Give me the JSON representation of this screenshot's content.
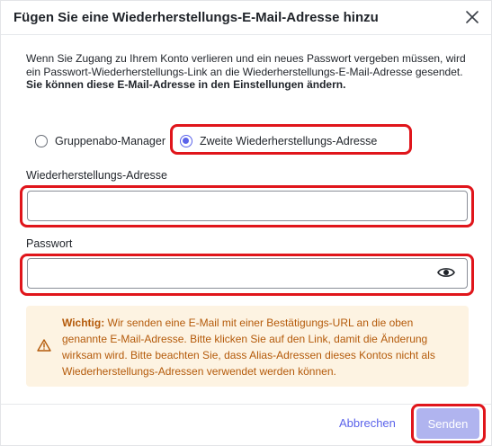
{
  "dialog": {
    "title": "Fügen Sie eine Wiederherstellungs-E-Mail-Adresse hinzu"
  },
  "intro": {
    "text": "Wenn Sie Zugang zu Ihrem Konto verlieren und ein neues Passwort vergeben müssen, wird ein Passwort-Wiederherstellungs-Link an die Wiederherstellungs-E-Mail-Adresse gesendet.",
    "bold": "Sie können diese E-Mail-Adresse in den Einstellungen ändern."
  },
  "radios": {
    "option1": "Gruppenabo-Manager",
    "option2": "Zweite Wiederherstellungs-Adresse",
    "selected": "option2"
  },
  "fields": {
    "address_label": "Wiederherstellungs-Adresse",
    "address_value": "",
    "password_label": "Passwort",
    "password_value": ""
  },
  "warning": {
    "strong": "Wichtig:",
    "text": " Wir senden eine E-Mail mit einer Bestätigungs-URL an die oben genannte E-Mail-Adresse. Bitte klicken Sie auf den Link, damit die Änderung wirksam wird. Bitte beachten Sie, dass Alias-Adressen dieses Kontos nicht als Wiederherstellungs-Adressen verwendet werden können."
  },
  "footer": {
    "cancel_label": "Abbrechen",
    "send_label": "Senden"
  },
  "colors": {
    "accent": "#5b63ea",
    "send_disabled": "#b0b4ef",
    "warning_bg": "#fdf3e2",
    "warning_text": "#b45a0a",
    "highlight": "#e0151b"
  },
  "icons": {
    "close": "close-icon",
    "eye": "eye-icon",
    "warning": "warning-triangle-icon"
  }
}
